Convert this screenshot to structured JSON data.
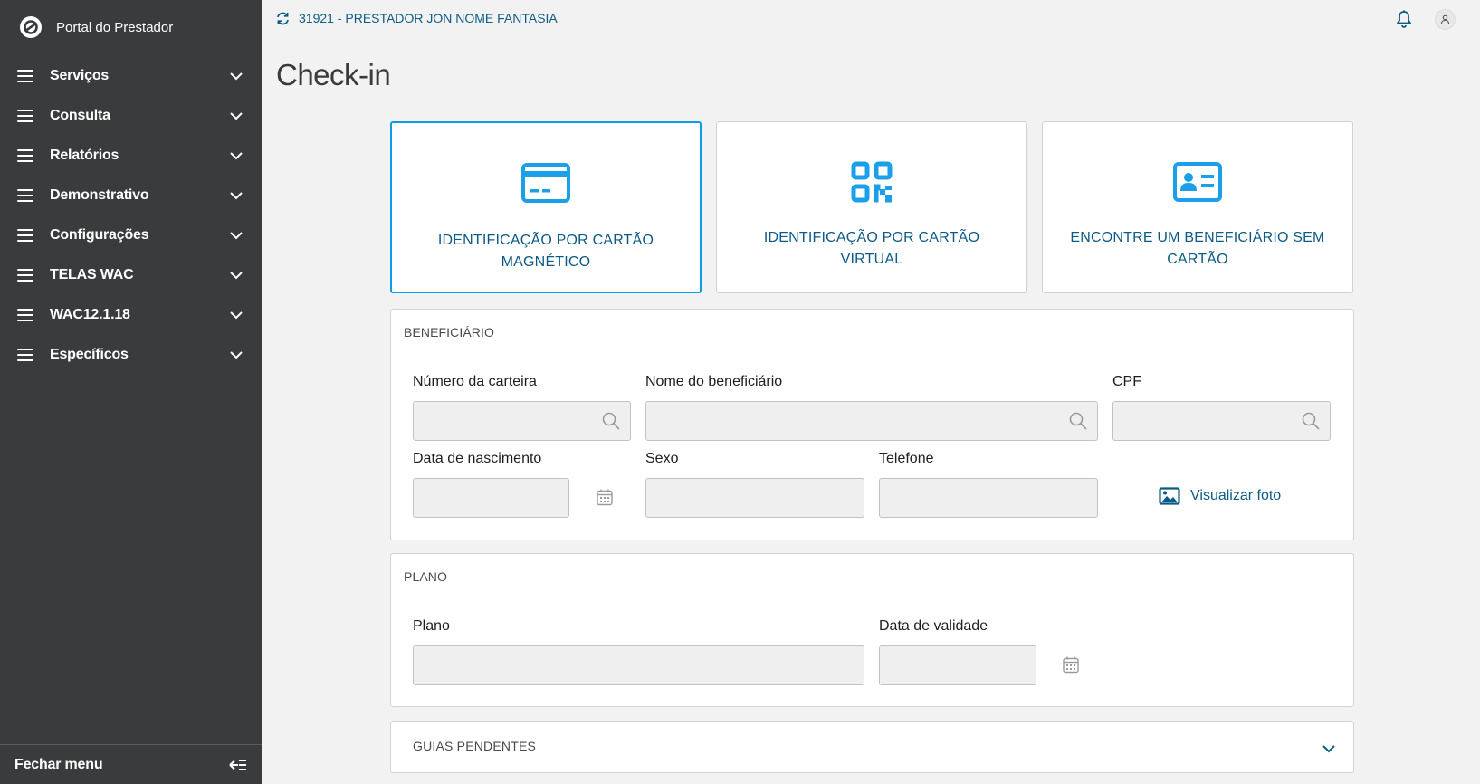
{
  "app": {
    "name": "Portal do Prestador"
  },
  "sidebar": {
    "items": [
      {
        "label": "Serviços"
      },
      {
        "label": "Consulta"
      },
      {
        "label": "Relatórios"
      },
      {
        "label": "Demonstrativo"
      },
      {
        "label": "Configurações"
      },
      {
        "label": "TELAS WAC"
      },
      {
        "label": "WAC12.1.18"
      },
      {
        "label": "Específicos"
      }
    ],
    "footer_label": "Fechar menu"
  },
  "header": {
    "provider": "31921 - PRESTADOR JON NOME FANTASIA"
  },
  "page": {
    "title": "Check-in"
  },
  "options": [
    {
      "label": "IDENTIFICAÇÃO POR CARTÃO MAGNÉTICO",
      "icon": "credit-card-icon",
      "selected": true
    },
    {
      "label": "IDENTIFICAÇÃO POR CARTÃO VIRTUAL",
      "icon": "qr-code-icon",
      "selected": false
    },
    {
      "label": "ENCONTRE UM BENEFICIÁRIO SEM CARTÃO",
      "icon": "id-card-icon",
      "selected": false
    }
  ],
  "beneficiario": {
    "title": "BENEFICIÁRIO",
    "numero_carteira": {
      "label": "Número da carteira",
      "value": ""
    },
    "nome": {
      "label": "Nome do beneficiário",
      "value": ""
    },
    "cpf": {
      "label": "CPF",
      "value": ""
    },
    "nascimento": {
      "label": "Data de nascimento",
      "value": ""
    },
    "sexo": {
      "label": "Sexo",
      "value": ""
    },
    "telefone": {
      "label": "Telefone",
      "value": ""
    },
    "photo_link": "Visualizar foto"
  },
  "plano": {
    "title": "PLANO",
    "plano": {
      "label": "Plano",
      "value": ""
    },
    "validade": {
      "label": "Data de validade",
      "value": ""
    }
  },
  "guias": {
    "title": "GUIAS PENDENTES"
  },
  "colors": {
    "sidebar_bg": "#3a3b3c",
    "accent": "#0c9be8",
    "link": "#0c5a86",
    "page_bg": "#f2f2f2"
  }
}
